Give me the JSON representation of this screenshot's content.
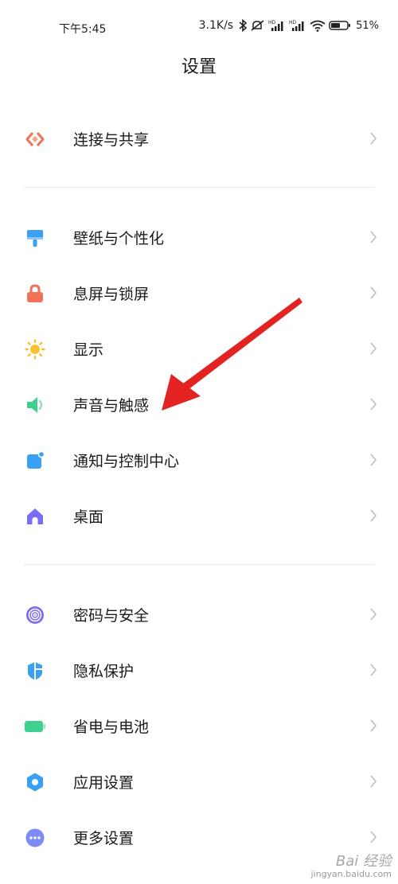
{
  "status_bar": {
    "time": "下午5:45",
    "network_speed": "3.1K/s",
    "battery_percent": "51%",
    "icons": [
      "bluetooth-icon",
      "mute-icon",
      "hd-signal-icon",
      "hd-signal-icon",
      "wifi-icon",
      "battery-icon"
    ]
  },
  "header": {
    "title": "设置"
  },
  "groups": [
    {
      "items": [
        {
          "label": "连接与共享",
          "icon": "share-icon",
          "color": "#f0735a"
        }
      ]
    },
    {
      "items": [
        {
          "label": "壁纸与个性化",
          "icon": "brush-icon",
          "color": "#3aa0f3"
        },
        {
          "label": "息屏与锁屏",
          "icon": "lock-icon",
          "color": "#f0735a"
        },
        {
          "label": "显示",
          "icon": "sun-icon",
          "color": "#f6c230"
        },
        {
          "label": "声音与触感",
          "icon": "speaker-icon",
          "color": "#3fcf8e"
        },
        {
          "label": "通知与控制中心",
          "icon": "notification-icon",
          "color": "#3aa0f3"
        },
        {
          "label": "桌面",
          "icon": "home-icon",
          "color": "#7b6cf6"
        }
      ]
    },
    {
      "items": [
        {
          "label": "密码与安全",
          "icon": "fingerprint-icon",
          "color": "#7b6cf6"
        },
        {
          "label": "隐私保护",
          "icon": "privacy-shield-icon",
          "color": "#3aa0f3"
        },
        {
          "label": "省电与电池",
          "icon": "battery-saver-icon",
          "color": "#3fcf8e"
        },
        {
          "label": "应用设置",
          "icon": "gear-icon",
          "color": "#3aa0f3"
        },
        {
          "label": "更多设置",
          "icon": "more-icon",
          "color": "#7b8cf6"
        }
      ]
    }
  ],
  "annotation": {
    "arrow_color": "#e32222"
  },
  "watermark": {
    "line1": "Bai 经验",
    "line2": "jingyan.baidu.com"
  }
}
